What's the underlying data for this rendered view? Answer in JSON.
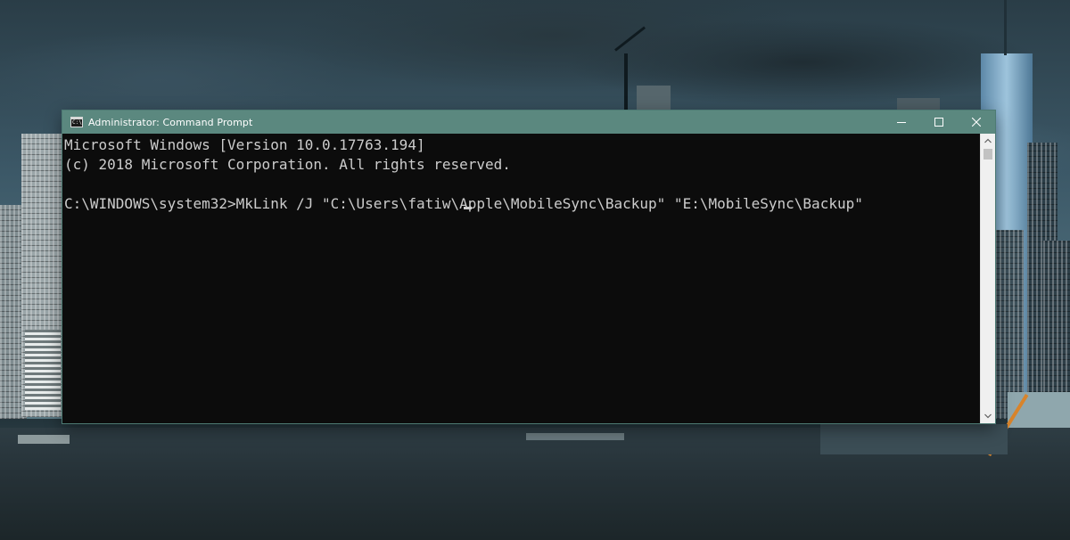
{
  "window": {
    "title": "Administrator: Command Prompt",
    "icon": "cmd-icon",
    "icon_text": "C:\\",
    "titlebar_color": "#5b887f",
    "buttons": {
      "minimize": "minimize-icon",
      "maximize": "maximize-icon",
      "close": "close-icon"
    }
  },
  "console": {
    "background": "#0c0c0c",
    "text_color": "#cccccc",
    "lines": [
      "Microsoft Windows [Version 10.0.17763.194]",
      "(c) 2018 Microsoft Corporation. All rights reserved.",
      "",
      "C:\\WINDOWS\\system32>MkLink /J \"C:\\Users\\fatiw\\Apple\\MobileSync\\Backup\" \"E:\\MobileSync\\Backup\""
    ]
  },
  "scrollbar": {
    "up_icon": "scroll-up-arrow-icon",
    "down_icon": "scroll-down-arrow-icon"
  }
}
